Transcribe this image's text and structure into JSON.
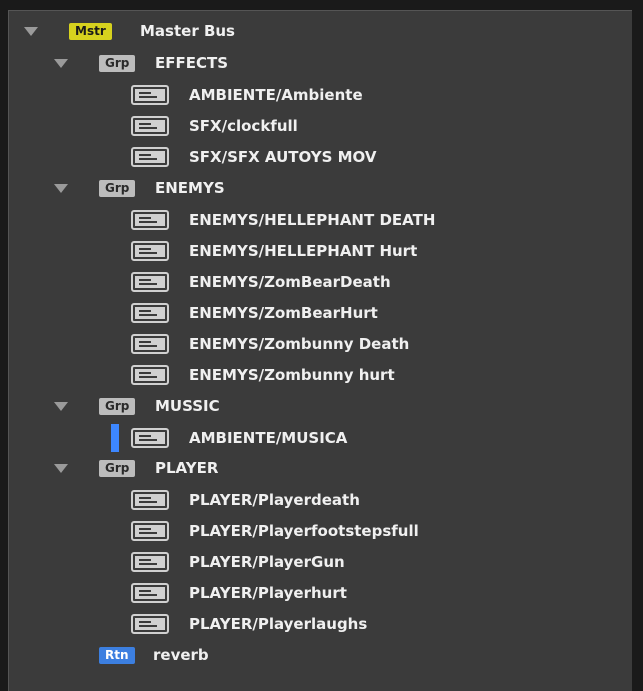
{
  "colors": {
    "master_badge": "#d7d21e",
    "group_badge": "#bcbcbc",
    "return_badge": "#3c7fe0",
    "selection": "#3d87ff"
  },
  "master": {
    "badge": "Mstr",
    "label": "Master Bus"
  },
  "groups": [
    {
      "badge": "Grp",
      "label": "EFFECTS",
      "events": [
        "AMBIENTE/Ambiente",
        "SFX/clockfull",
        "SFX/SFX AUTOYS MOV"
      ]
    },
    {
      "badge": "Grp",
      "label": "ENEMYS",
      "events": [
        "ENEMYS/HELLEPHANT DEATH",
        "ENEMYS/HELLEPHANT Hurt",
        "ENEMYS/ZomBearDeath",
        "ENEMYS/ZomBearHurt",
        "ENEMYS/Zombunny Death",
        "ENEMYS/Zombunny hurt"
      ]
    },
    {
      "badge": "Grp",
      "label": "MUSSIC",
      "events": [
        "AMBIENTE/MUSICA"
      ]
    },
    {
      "badge": "Grp",
      "label": "PLAYER",
      "events": [
        "PLAYER/Playerdeath",
        "PLAYER/Playerfootstepsfull",
        "PLAYER/PlayerGun",
        "PLAYER/Playerhurt",
        "PLAYER/Playerlaughs"
      ]
    }
  ],
  "return_bus": {
    "badge": "Rtn",
    "label": "reverb"
  }
}
